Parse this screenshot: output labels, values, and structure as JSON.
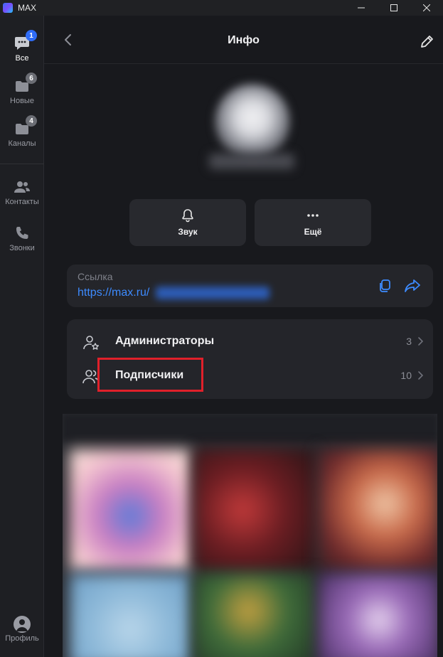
{
  "window": {
    "title": "MAX",
    "minimize_icon": "minimize-icon",
    "maximize_icon": "maximize-icon",
    "close_icon": "close-icon"
  },
  "sidebar": {
    "items": [
      {
        "label": "Все",
        "icon": "chat-bubble-icon",
        "badge": "1",
        "badge_color": "#2f6cf6",
        "active": true
      },
      {
        "label": "Новые",
        "icon": "folder-icon",
        "badge": "6",
        "badge_color": "#6b6d74"
      },
      {
        "label": "Каналы",
        "icon": "folder-icon",
        "badge": "4",
        "badge_color": "#6b6d74"
      },
      {
        "label": "Контакты",
        "icon": "contacts-icon"
      },
      {
        "label": "Звонки",
        "icon": "phone-icon"
      }
    ],
    "profile_label": "Профиль"
  },
  "header": {
    "title": "Инфо"
  },
  "actions": [
    {
      "label": "Звук",
      "icon": "bell-icon"
    },
    {
      "label": "Ещё",
      "icon": "more-dots-icon"
    }
  ],
  "link": {
    "label": "Ссылка",
    "value": "https://max.ru/"
  },
  "members": [
    {
      "label": "Администраторы",
      "count": "3",
      "icon": "admin-user-icon"
    },
    {
      "label": "Подписчики",
      "count": "10",
      "icon": "subscribers-icon"
    }
  ],
  "colors": {
    "accent": "#3d8bff",
    "highlight": "#e0202a",
    "background": "#18191d",
    "card": "#24252a"
  }
}
